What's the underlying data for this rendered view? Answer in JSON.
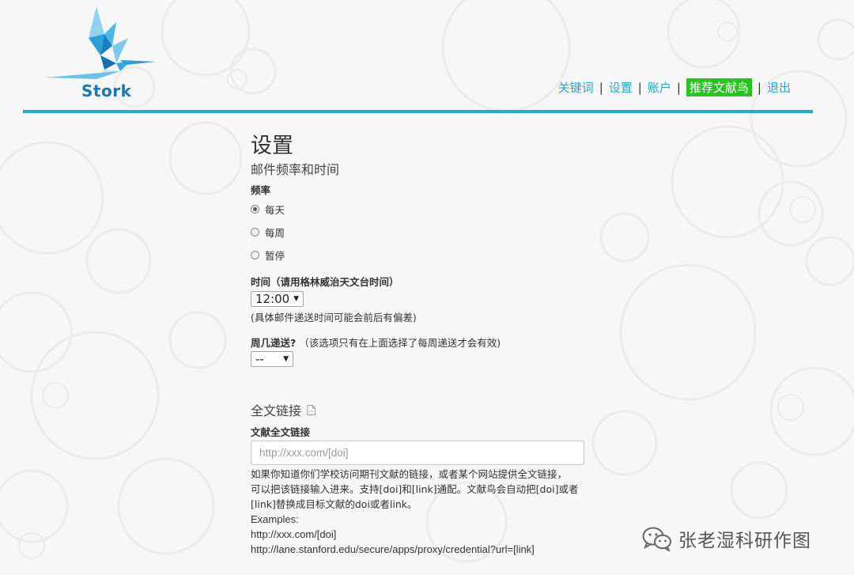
{
  "brand": {
    "name": "Stork"
  },
  "nav": {
    "keywords": "关键词",
    "settings": "设置",
    "account": "账户",
    "recommend": "推荐文献鸟",
    "logout": "退出",
    "separator": "|"
  },
  "page": {
    "title": "设置",
    "email_section_title": "邮件频率和时间",
    "frequency_label": "频率",
    "frequency_options": [
      "每天",
      "每周",
      "暂停"
    ],
    "frequency_selected": "每天",
    "time_label": "时间（请用格林威治天文台时间）",
    "time_value": "12:00",
    "time_note": "(具体邮件递送时间可能会前后有偏差)",
    "weekday_label": "周几递送?",
    "weekday_note": "（该选项只有在上面选择了每周递送才会有效)",
    "weekday_value": "--",
    "fulltext_section_title": "全文链接",
    "fulltext_label": "文献全文链接",
    "fulltext_placeholder": "http://xxx.com/[doi]",
    "help_line1": "如果你知道你们学校访问期刊文献的链接，或者某个网站提供全文链接，",
    "help_line2": "可以把该链接输入进来。支持[doi]和[link]通配。文献鸟会自动把[doi]或者",
    "help_line3": "[link]替换成目标文献的doi或者link。",
    "examples_label": "Examples:",
    "example1": "http://xxx.com/[doi]",
    "example2": "http://lane.stanford.edu/secure/apps/proxy/credential?url=[link]"
  },
  "watermark": {
    "text": "张老湿科研作图",
    "icon": "wechat-icon"
  },
  "colors": {
    "accent": "#1ab0d2",
    "nav_link": "#2aa6c9",
    "recommend_bg": "#29c41f",
    "logo_blue": "#1a78b3"
  }
}
